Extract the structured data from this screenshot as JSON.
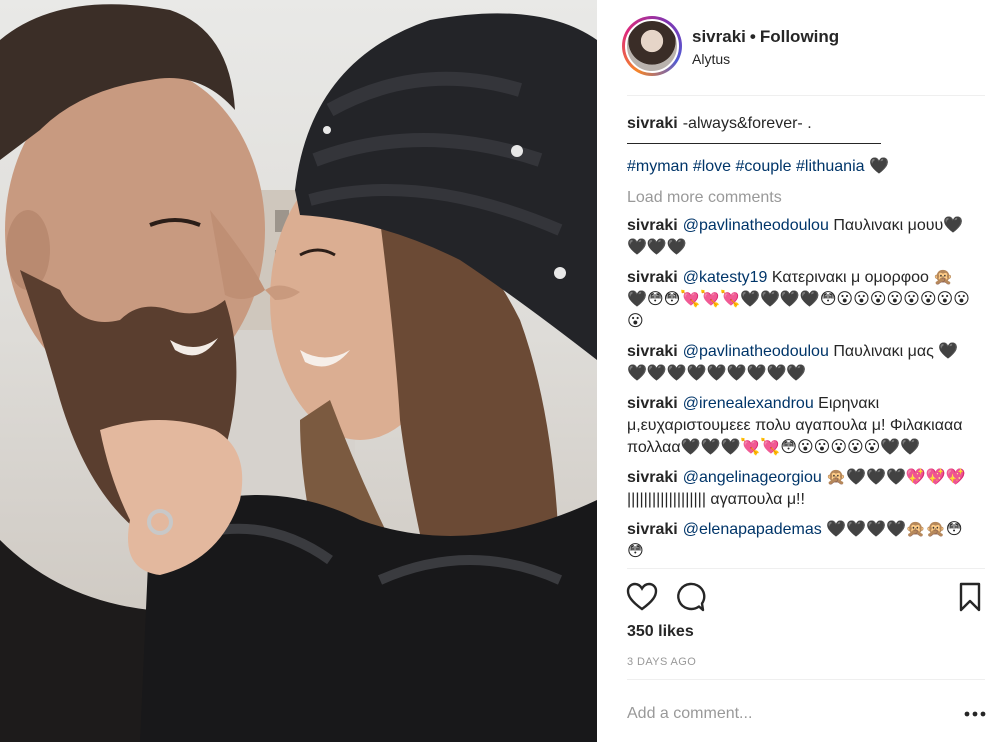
{
  "post": {
    "image_alt": "Couple touching noses, man with beard and woman in knitted black beanie"
  },
  "header": {
    "username": "sivraki",
    "separator": "•",
    "follow_label": "Following",
    "location": "Alytus"
  },
  "caption": {
    "username": "sivraki",
    "text": "-always&forever- .",
    "hashtags": [
      "#myman",
      "#love",
      "#couple",
      "#lithuania"
    ],
    "trailing": "🖤"
  },
  "load_more_label": "Load more comments",
  "comments": [
    {
      "username": "sivraki",
      "mention": "@pavlinatheodoulou",
      "text": "Παυλινακι μουυ🖤🖤🖤🖤"
    },
    {
      "username": "sivraki",
      "mention": "@katesty19",
      "text": "Κατερινακι μ ομορφοο 🙊🖤😳😳💘💘💘🖤🖤🖤🖤😳😮😮😮😮😮😮😮😮😮"
    },
    {
      "username": "sivraki",
      "mention": "@pavlinatheodoulou",
      "text": "Παυλινακι μας 🖤🖤🖤🖤🖤🖤🖤🖤🖤🖤"
    },
    {
      "username": "sivraki",
      "mention": "@irenealexandrou",
      "text": "Ειρηνακι μ,ευχαριστουμεεε πολυ αγαπουλα μ! Φιλακιααα πολλαα🖤🖤🖤💘💘😳😮😮😮😮😮🖤🖤"
    },
    {
      "username": "sivraki",
      "mention": "@angelinageorgiou",
      "text": "🙊🖤🖤🖤💖💖💖 ||||||||||||||||||| αγαπουλα μ!!"
    },
    {
      "username": "sivraki",
      "mention": "@elenapapademas",
      "text": "🖤🖤🖤🖤🙊🙊😳😳"
    }
  ],
  "actions": {
    "like_icon": "heart-outline-icon",
    "comment_icon": "speech-bubble-icon",
    "save_icon": "bookmark-icon"
  },
  "likes": "350 likes",
  "time_ago": "3 DAYS AGO",
  "add_comment": {
    "placeholder": "Add a comment..."
  },
  "more_icon": "ellipsis-icon",
  "colors": {
    "link": "#003569",
    "muted": "#999999",
    "text": "#262626",
    "divider": "#efefef"
  }
}
